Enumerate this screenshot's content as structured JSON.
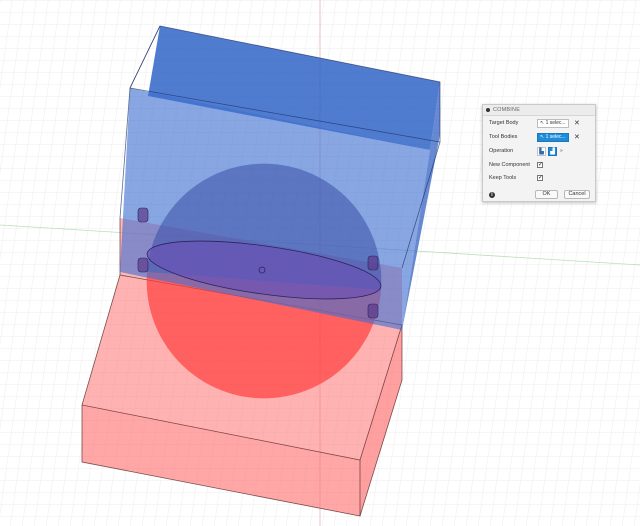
{
  "dialog": {
    "title": "COMBINE",
    "target_body_label": "Target Body",
    "target_body_value": "1 selec...",
    "tool_bodies_label": "Tool Bodies",
    "tool_bodies_value": "1 selec...",
    "operation_label": "Operation",
    "operation_options": [
      "join-icon",
      "cut-icon",
      "intersect-icon"
    ],
    "operation_selected": "cut-icon",
    "new_component_label": "New Component",
    "new_component_checked": true,
    "keep_tools_label": "Keep Tools",
    "keep_tools_checked": true,
    "ok_label": "OK",
    "cancel_label": "Cancel",
    "checkmark": "✓",
    "close_glyph": "✕"
  },
  "colors": {
    "target_body": "#3f6fd0",
    "tool_body": "#ff5a5a",
    "accent": "#1e8cd8",
    "grid": "#dcdcdc"
  }
}
